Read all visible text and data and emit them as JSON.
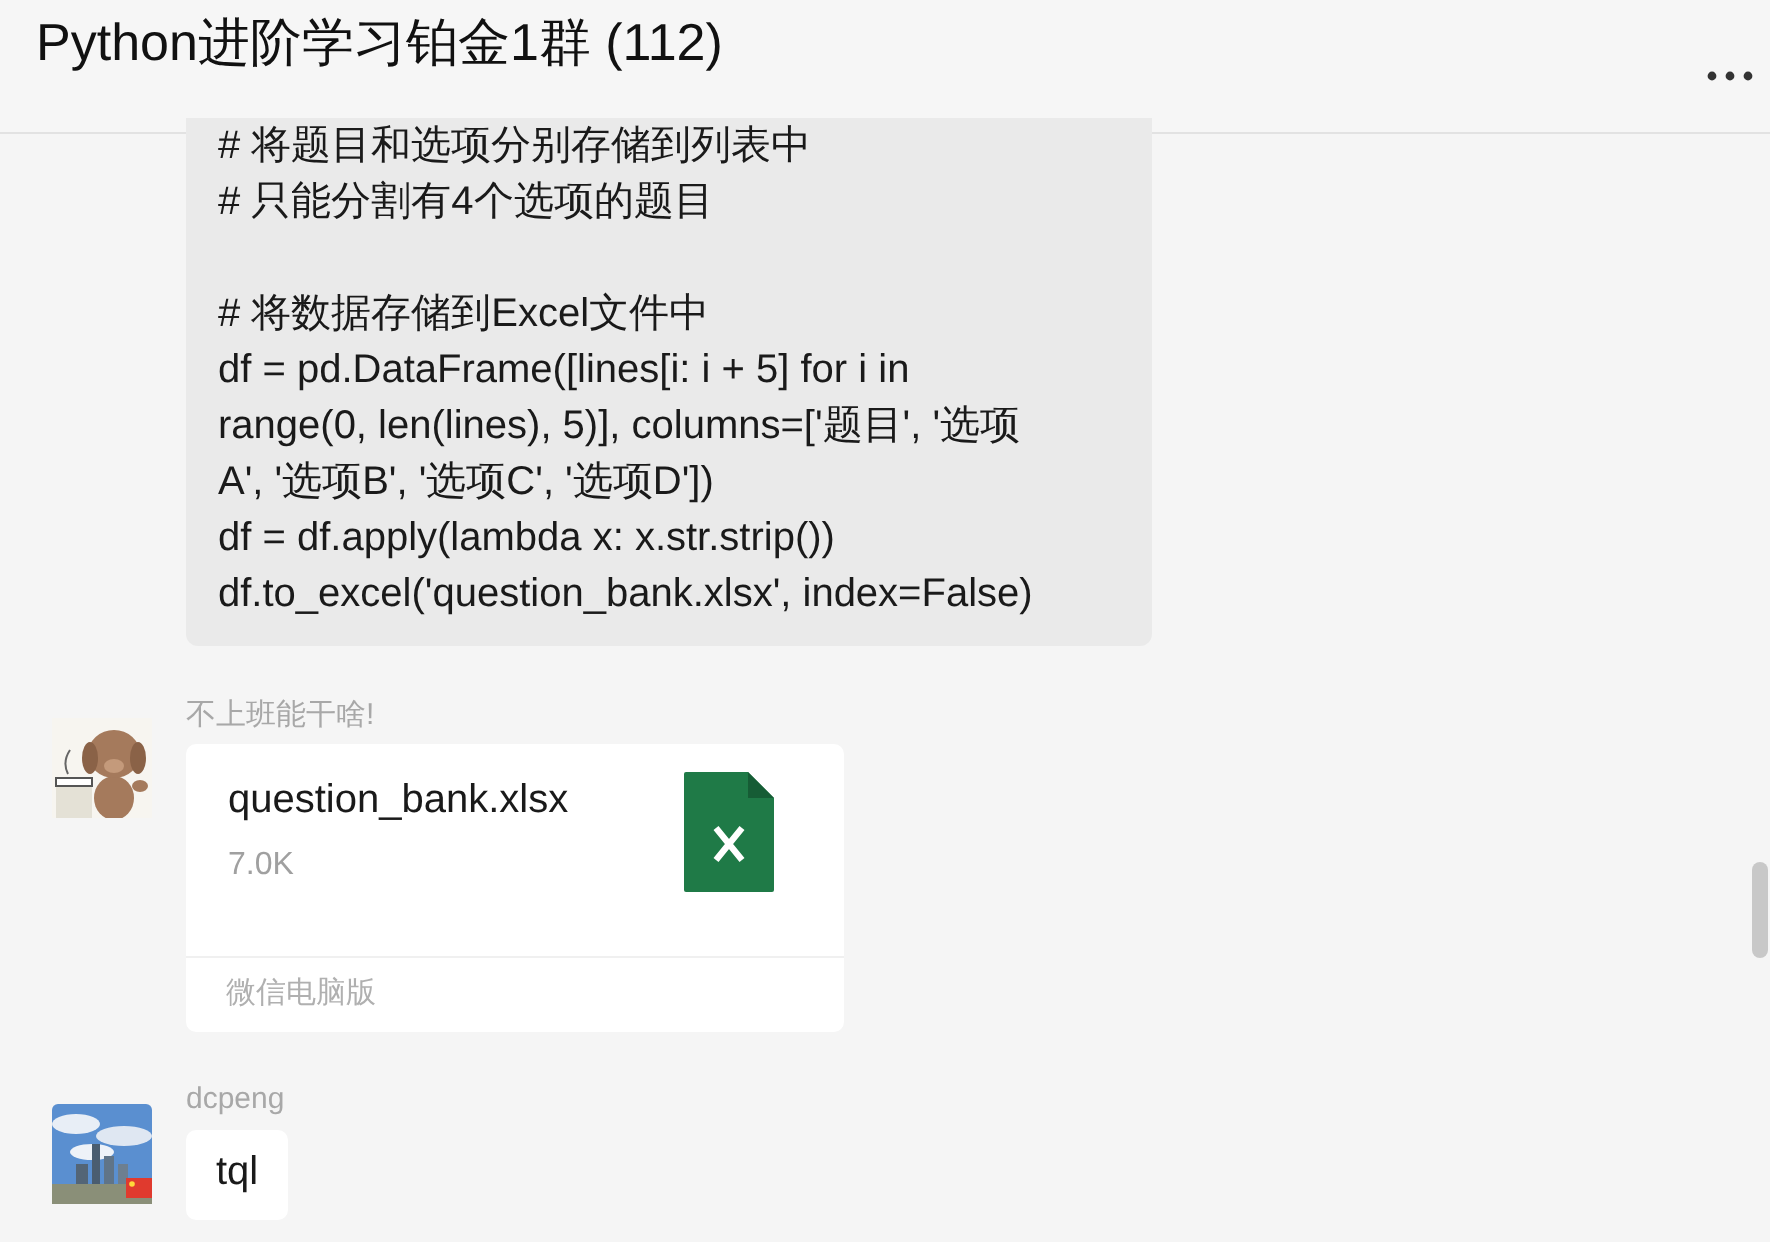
{
  "header": {
    "title": "Python进阶学习铂金1群 (112)"
  },
  "messages": [
    {
      "kind": "code",
      "paragraphs": [
        [
          "# 将题目和选项分别存储到列表中",
          "# 只能分割有4个选项的题目"
        ],
        [
          "# 将数据存储到Excel文件中",
          "df = pd.DataFrame([lines[i: i + 5] for i in",
          "range(0, len(lines), 5)], columns=['题目', '选项",
          "A', '选项B', '选项C', '选项D'])",
          "df = df.apply(lambda x: x.str.strip())",
          "df.to_excel('question_bank.xlsx', index=False)"
        ]
      ]
    },
    {
      "kind": "file",
      "sender": "不上班能干啥!",
      "file_name": "question_bank.xlsx",
      "file_size": "7.0K",
      "footer": "微信电脑版"
    },
    {
      "kind": "text",
      "sender": "dcpeng",
      "text": "tql"
    }
  ]
}
